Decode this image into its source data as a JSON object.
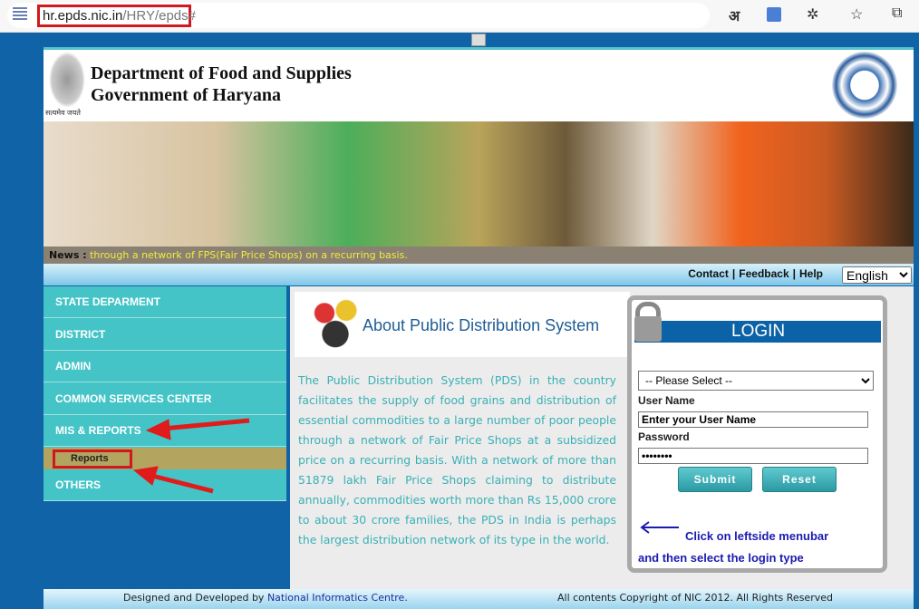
{
  "browser": {
    "url_host": "hr.epds.nic.in",
    "url_path": "/HRY/epds#",
    "icons": [
      "site-icon",
      "translate-hindi-icon",
      "translate-icon",
      "extensions-icon",
      "favorites-icon",
      "collections-icon"
    ],
    "hindi_glyph": "अ"
  },
  "header": {
    "line1": "Department of Food and Supplies",
    "line2": "Government of Haryana",
    "emblem_motto": "सत्यमेव जयते"
  },
  "news": {
    "label": "News :",
    "text": "through a network of FPS(Fair Price Shops) on a recurring basis."
  },
  "nav": {
    "links": [
      "Contact",
      "Feedback",
      "Help"
    ],
    "language": "English"
  },
  "sidebar": {
    "items": [
      "STATE DEPARMENT",
      "DISTRICT",
      "ADMIN",
      "COMMON SERVICES CENTER",
      "MIS & REPORTS"
    ],
    "sub_item": "Reports",
    "last_item": "OTHERS"
  },
  "about": {
    "title": "About Public Distribution System",
    "text": "The Public Distribution System (PDS) in the country facilitates the supply of food grains and distribution of essential commodities to a large number of poor people through a network of Fair Price Shops at a subsidized price on a recurring basis. With a network of more than 51879 lakh Fair Price Shops claiming to distribute annually, commodities worth more than Rs 15,000 crore to about 30 crore families, the PDS in India is perhaps the largest distribution network of its type in the world."
  },
  "login": {
    "title": "LOGIN",
    "select_value": "-- Please Select --",
    "username_label": "User Name",
    "username_value": "Enter your User Name",
    "password_label": "Password",
    "password_value": "password",
    "submit": "Submit",
    "reset": "Reset",
    "hint1": "Click on leftside menubar",
    "hint2": "and then select the login type"
  },
  "footer": {
    "designed": "Designed and Developed by",
    "nic": "National Informatics Centre.",
    "copyright": "All contents Copyright of NIC 2012. All Rights Reserved"
  },
  "colors": {
    "page_bg": "#0f63a6",
    "sidebar": "#44c4c6",
    "annotation": "#d0181e",
    "login_header": "#0b62a6"
  }
}
